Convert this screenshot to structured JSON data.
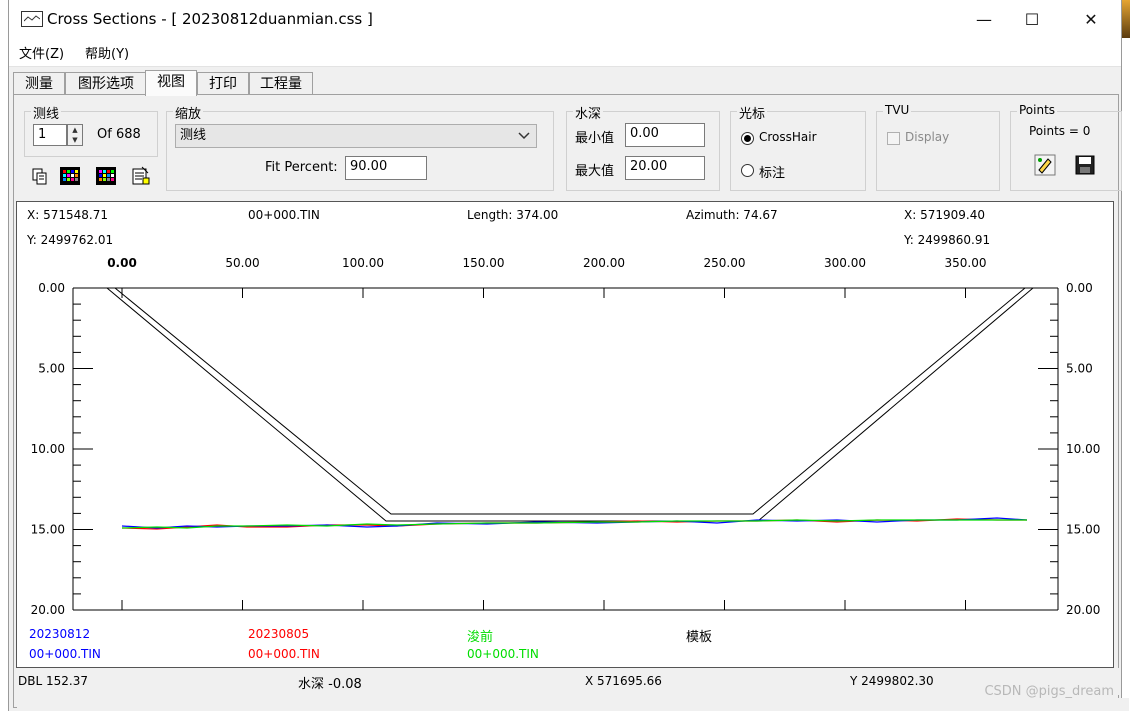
{
  "window": {
    "title": "Cross Sections - [ 20230812duanmian.css ]",
    "minimize": "—",
    "maximize": "☐",
    "close": "✕"
  },
  "menu": [
    "文件(Z)",
    "帮助(Y)"
  ],
  "tabs": [
    {
      "label": "测量",
      "active": false
    },
    {
      "label": "图形选项",
      "active": false
    },
    {
      "label": "视图",
      "active": true
    },
    {
      "label": "打印",
      "active": false
    },
    {
      "label": "工程量",
      "active": false
    }
  ],
  "survey_line": {
    "group": "测线",
    "value": "1",
    "of": "Of 688"
  },
  "zoom": {
    "group": "缩放",
    "selected": "测线",
    "fit_label": "Fit Percent:",
    "fit_value": "90.00"
  },
  "depth": {
    "group": "水深",
    "min_label": "最小值",
    "min_value": "0.00",
    "max_label": "最大值",
    "max_value": "20.00"
  },
  "cursor": {
    "group": "光标",
    "options": [
      "CrossHair",
      "标注"
    ],
    "selected": "CrossHair"
  },
  "tvu": {
    "group": "TVU",
    "display_label": "Display",
    "checked": false
  },
  "points": {
    "group": "Points",
    "count": "Points = 0"
  },
  "plot": {
    "header": {
      "x_left": "X: 571548.71",
      "y_left": "Y: 2499762.01",
      "station": "00+000.TIN",
      "length": "Length: 374.00",
      "azimuth": "Azimuth: 74.67",
      "x_right": "X: 571909.40",
      "y_right": "Y: 2499860.91"
    },
    "x_ticks": [
      "0.00",
      "50.00",
      "100.00",
      "150.00",
      "200.00",
      "250.00",
      "300.00",
      "350.00"
    ],
    "y_ticks": [
      "0.00",
      "5.00",
      "10.00",
      "15.00",
      "20.00"
    ],
    "legend": [
      {
        "name": "20230812",
        "file": "00+000.TIN",
        "color": "#0000ff"
      },
      {
        "name": "20230805",
        "file": "00+000.TIN",
        "color": "#ff0000"
      },
      {
        "name": "浚前",
        "file": "00+000.TIN",
        "color": "#00dd00"
      },
      {
        "name": "模板",
        "file": "",
        "color": "#000000"
      }
    ]
  },
  "status": {
    "dbl": "DBL 152.37",
    "depth": "水深 -0.08",
    "x": "X 571695.66",
    "y": "Y 2499802.30"
  },
  "watermark": "CSDN @pigs_dream",
  "colors": {
    "accent": "#0000ff",
    "template_line": "#000000"
  }
}
